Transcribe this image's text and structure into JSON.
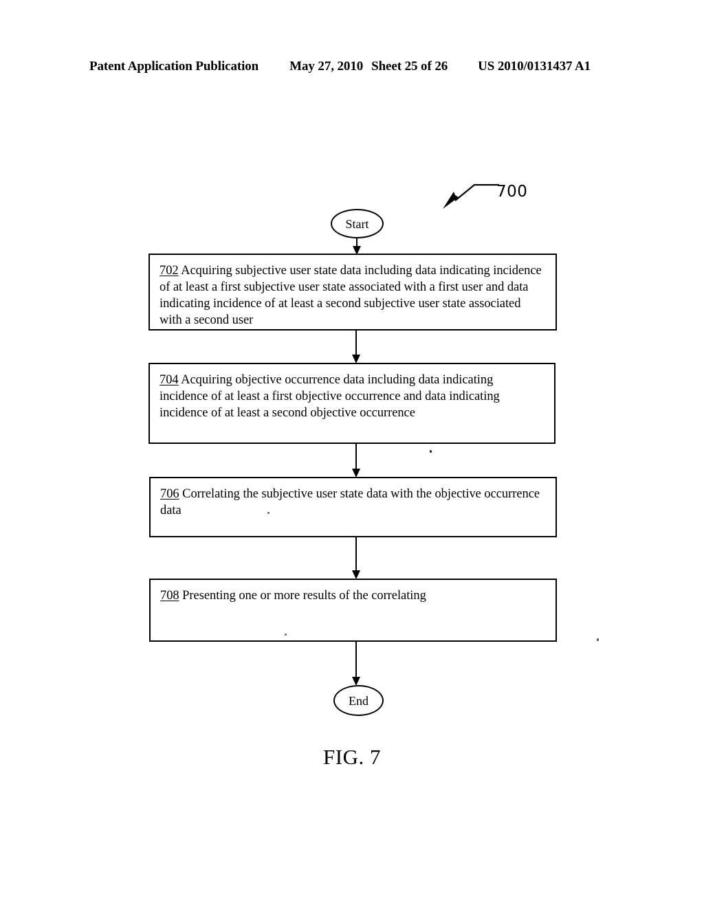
{
  "header": {
    "publication": "Patent Application Publication",
    "date": "May 27, 2010",
    "sheet": "Sheet 25 of 26",
    "patent_number": "US 2010/0131437 A1"
  },
  "figure": {
    "caption": "FIG. 7",
    "reference_numeral": "700",
    "start_label": "Start",
    "end_label": "End",
    "steps": [
      {
        "ref": "702",
        "text": " Acquiring subjective user state data including data indicating incidence of at least a first subjective user state associated with a first user and data indicating incidence of at least a second subjective user state associated with a second user"
      },
      {
        "ref": "704",
        "text": " Acquiring objective occurrence data including data indicating incidence of at least a first objective occurrence and data indicating incidence of at least a second objective occurrence"
      },
      {
        "ref": "706",
        "text": " Correlating the subjective user state data with the objective occurrence data"
      },
      {
        "ref": "708",
        "text": " Presenting one or more results of the correlating"
      }
    ]
  },
  "colors": {
    "ink": "#000000",
    "page": "#ffffff"
  }
}
